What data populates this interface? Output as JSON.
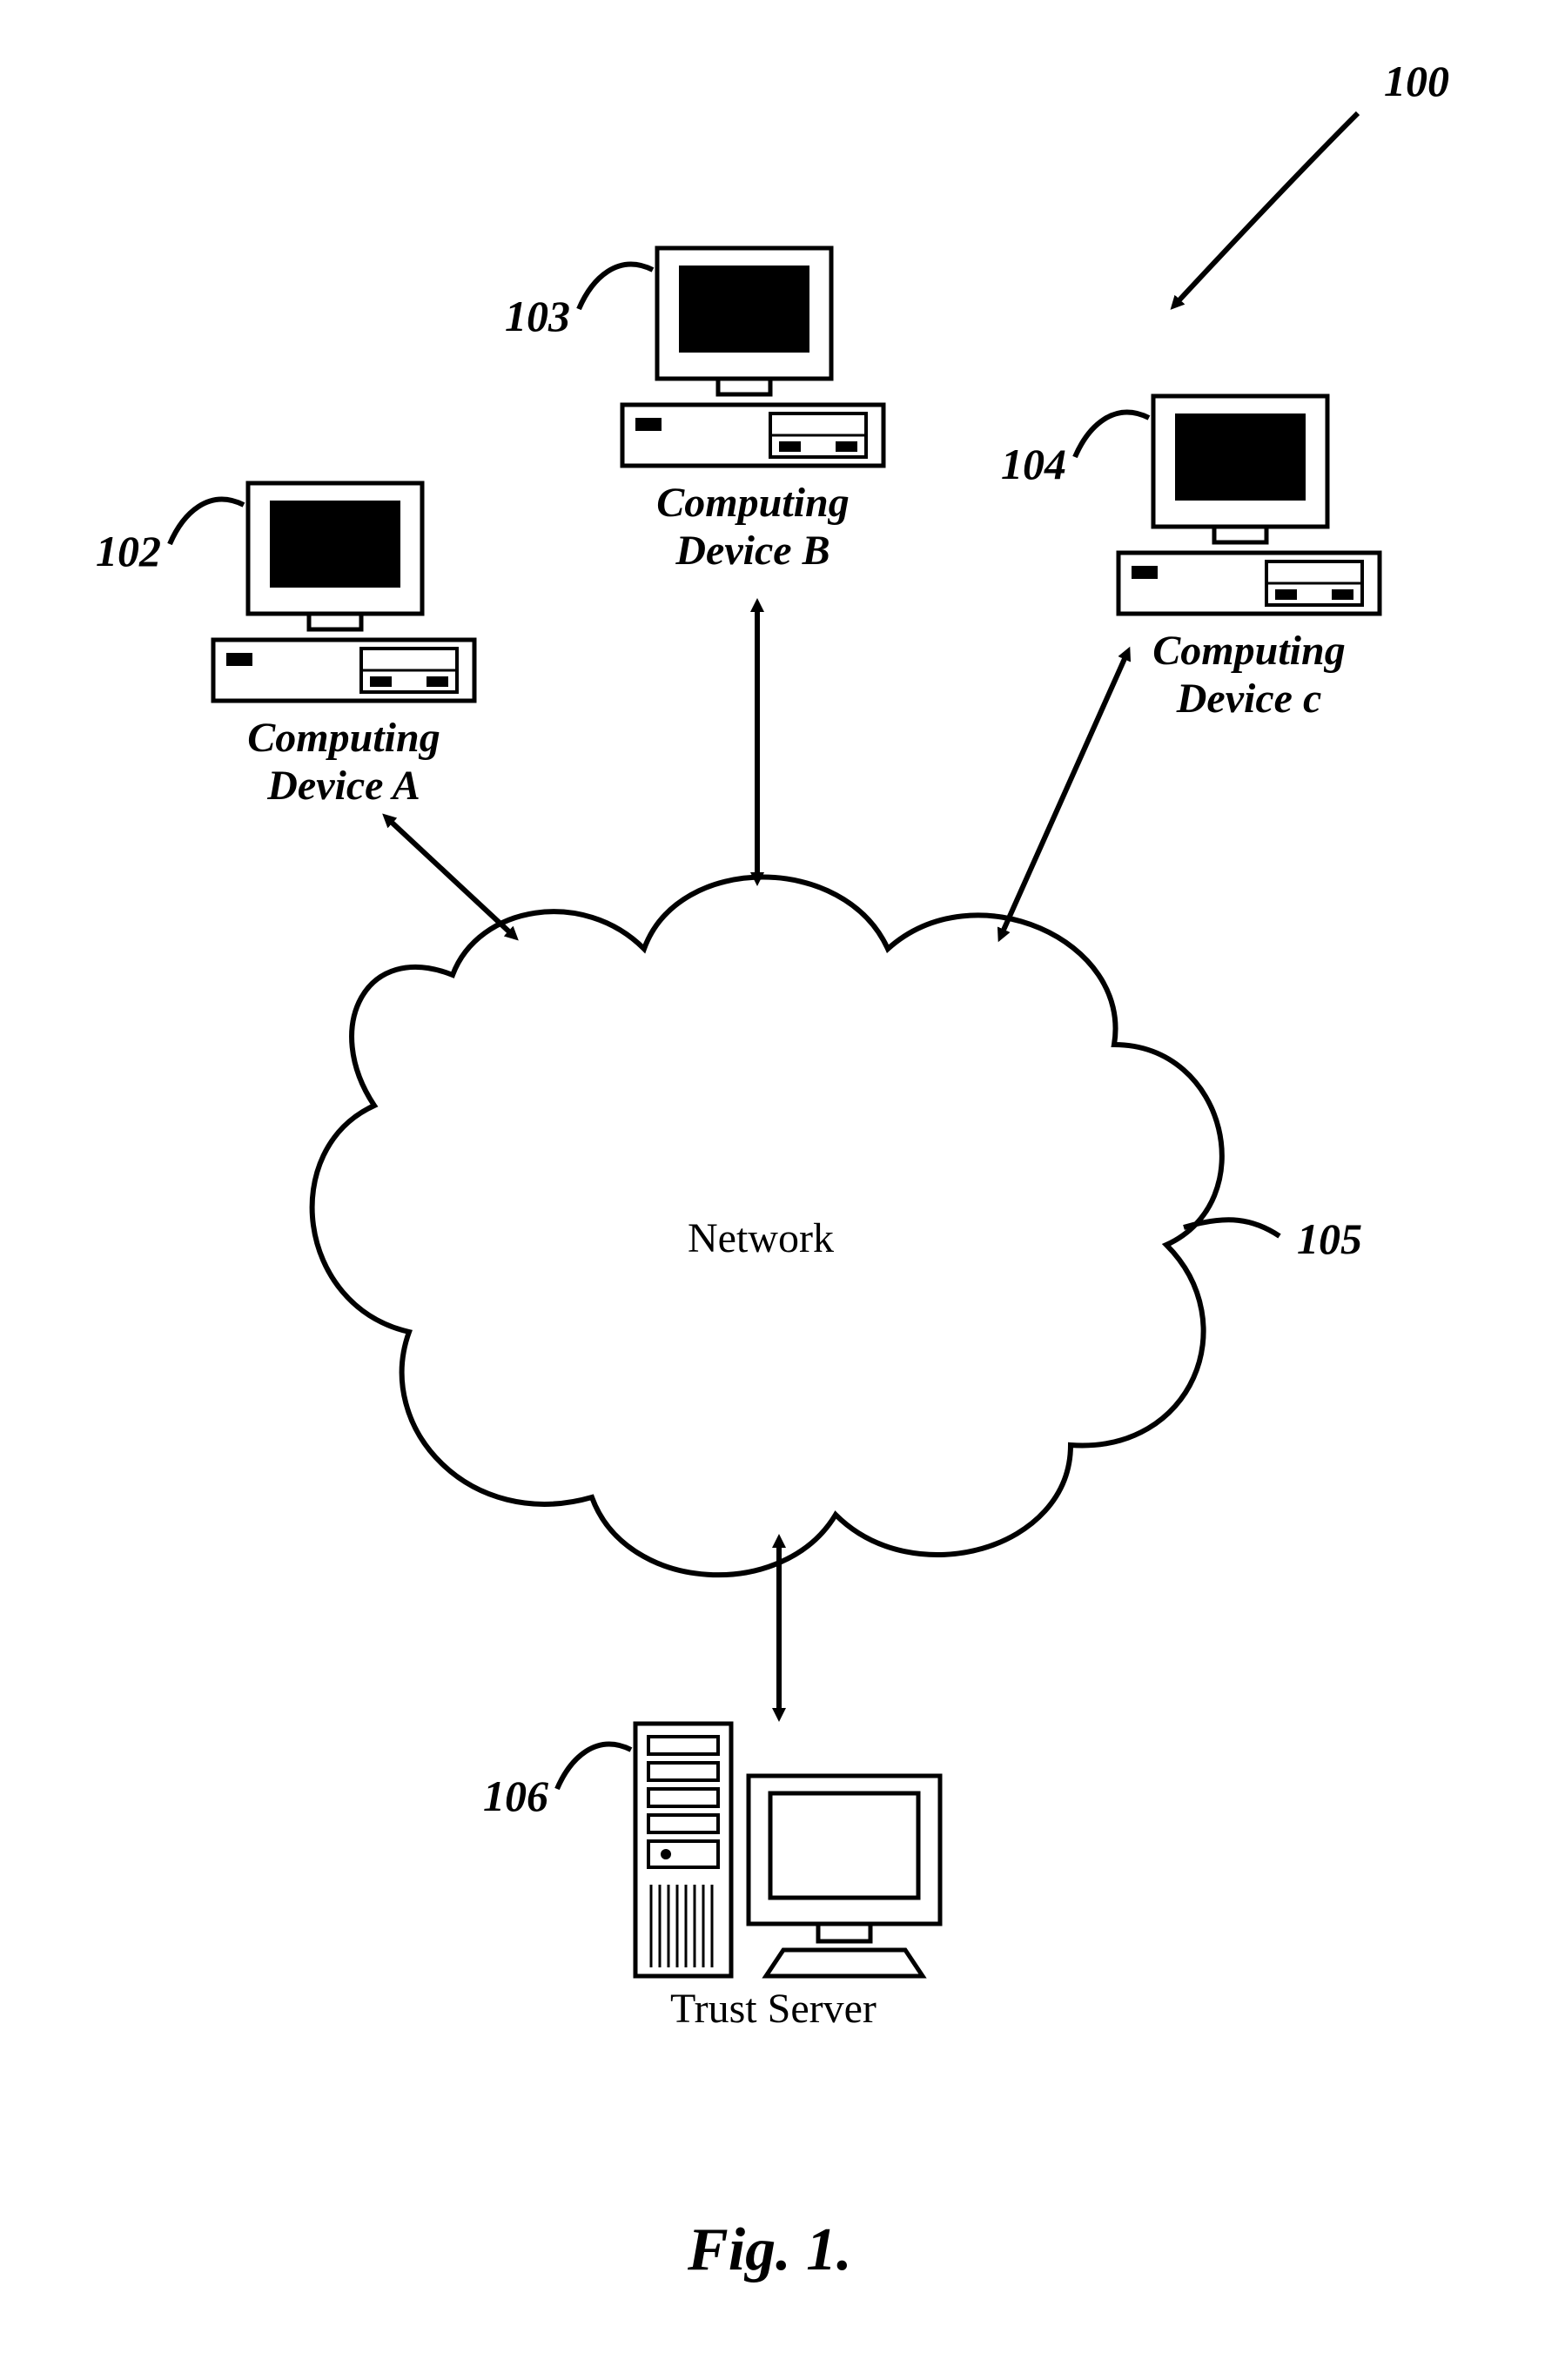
{
  "figure": {
    "title": "Fig. 1.",
    "overall_ref": "100"
  },
  "network": {
    "label": "Network",
    "ref": "105"
  },
  "devices": {
    "a": {
      "label": "Computing\nDevice A",
      "ref": "102"
    },
    "b": {
      "label": "Computing\nDevice B",
      "ref": "103"
    },
    "c": {
      "label": "Computing\nDevice c",
      "ref": "104"
    }
  },
  "server": {
    "label": "Trust Server",
    "ref": "106"
  }
}
